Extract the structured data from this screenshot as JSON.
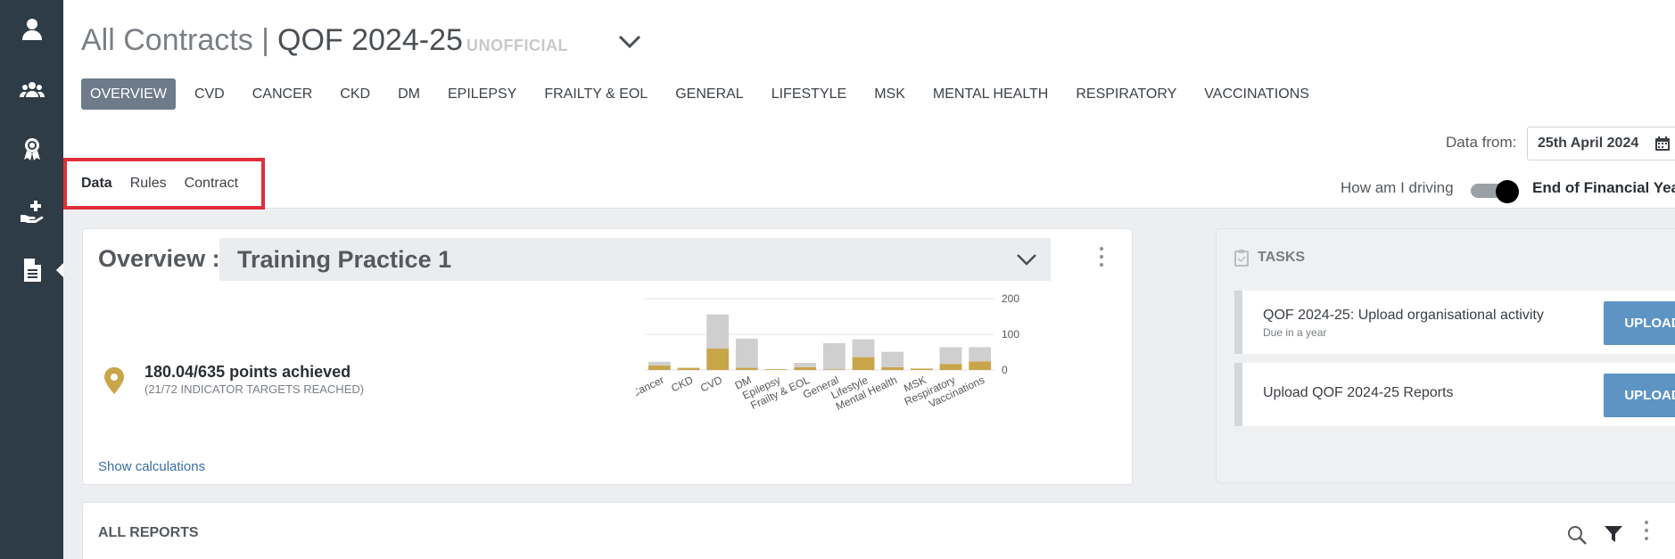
{
  "sidebar": {
    "items": [
      {
        "icon": "user-icon"
      },
      {
        "icon": "group-icon"
      },
      {
        "icon": "award-ribbon-icon"
      },
      {
        "icon": "hand-medical-icon"
      },
      {
        "icon": "document-icon",
        "active": true
      }
    ]
  },
  "header": {
    "title_main": "All Contracts |",
    "title_contract": "QOF 2024-25",
    "status": "UNOFFICIAL",
    "tabs": [
      {
        "label": "OVERVIEW",
        "active": true
      },
      {
        "label": "CVD"
      },
      {
        "label": "CANCER"
      },
      {
        "label": "CKD"
      },
      {
        "label": "DM"
      },
      {
        "label": "EPILEPSY"
      },
      {
        "label": "FRAILTY & EOL"
      },
      {
        "label": "GENERAL"
      },
      {
        "label": "LIFESTYLE"
      },
      {
        "label": "MSK"
      },
      {
        "label": "MENTAL HEALTH"
      },
      {
        "label": "RESPIRATORY"
      },
      {
        "label": "VACCINATIONS"
      }
    ],
    "subtabs": [
      {
        "label": "Data",
        "active": true
      },
      {
        "label": "Rules"
      },
      {
        "label": "Contract"
      }
    ],
    "data_from_label": "Data from:",
    "data_from_value": "25th April 2024",
    "driving_label": "How am I driving",
    "toggle_on": true,
    "eofy_label": "End of Financial Year"
  },
  "overview": {
    "title": "Overview :",
    "practice": "Training Practice 1",
    "points": "180.04/635 points achieved",
    "targets": "(21/72 INDICATOR TARGETS REACHED)",
    "show_calc": "Show calculations"
  },
  "chart_data": {
    "type": "bar",
    "stacked": true,
    "categories": [
      "Cancer",
      "CKD",
      "CVD",
      "DM",
      "Epilepsy",
      "Frailty & EOL",
      "General",
      "Lifestyle",
      "Mental Health",
      "MSK",
      "Respiratory",
      "Vaccinations"
    ],
    "series": [
      {
        "values": [
          13,
          6,
          60,
          6,
          2,
          8,
          2,
          36,
          8,
          4,
          17,
          24
        ],
        "color": "#c9a54a"
      },
      {
        "values": [
          10,
          0,
          96,
          82,
          0,
          12,
          73,
          50,
          43,
          0,
          47,
          40
        ],
        "color": "#cfcfcf"
      }
    ],
    "ylim": [
      0,
      200
    ],
    "yticks": [
      0,
      100,
      200
    ],
    "grid": true
  },
  "tasks": {
    "title": "TASKS",
    "items": [
      {
        "title": "QOF 2024-25: Upload organisational activity",
        "sub": "Due in a year",
        "button": "UPLOAD"
      },
      {
        "title": "Upload QOF 2024-25 Reports",
        "sub": "",
        "button": "UPLOAD"
      }
    ]
  },
  "reports": {
    "title": "ALL REPORTS"
  },
  "colors": {
    "sidebar": "#2e3c47",
    "accent_gold": "#c9a54a",
    "upload_button": "#5d94c4",
    "active_tab": "#6d7b8a",
    "highlight_box": "#e02f3b"
  }
}
